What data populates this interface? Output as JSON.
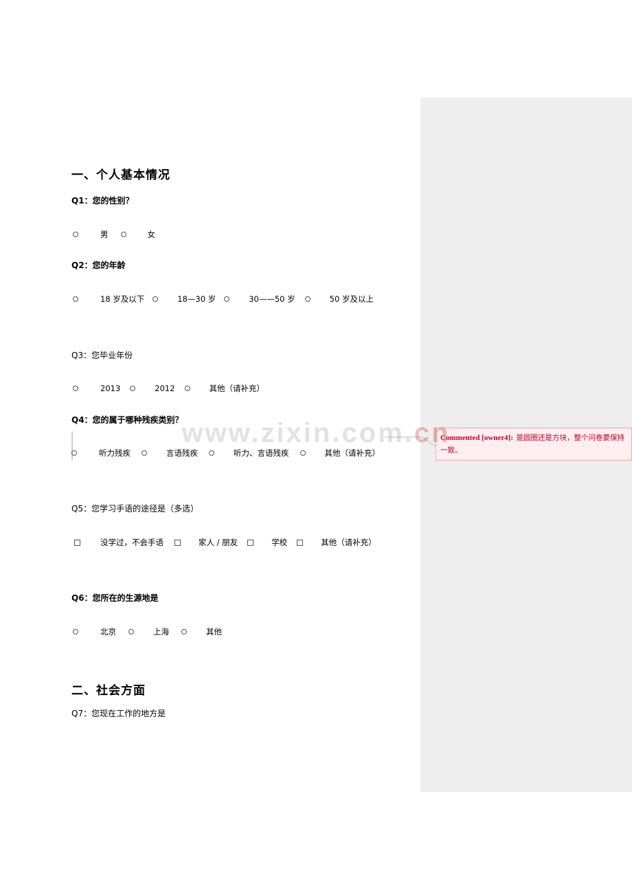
{
  "document": {
    "section1_title": "一、个人基本情况",
    "section2_title": "二、社会方面",
    "questions": [
      {
        "id": "q1",
        "label": "Q1：您的性别？",
        "bold": true,
        "input_type": "radio",
        "options": [
          "男",
          "女"
        ]
      },
      {
        "id": "q2",
        "label": "Q2：您的年龄",
        "bold": true,
        "input_type": "radio",
        "options": [
          "18 岁及以下",
          "18—30 岁",
          "30——50 岁",
          "50 岁及以上"
        ]
      },
      {
        "id": "q3",
        "label": "Q3：您毕业年份",
        "bold": false,
        "input_type": "radio",
        "options": [
          "2013",
          "2012",
          "其他（请补充）"
        ]
      },
      {
        "id": "q4",
        "label": "Q4：您的属于哪种残疾类别？",
        "bold": true,
        "input_type": "radio",
        "options": [
          "听力残疾",
          "言语残疾",
          "听力、言语残疾",
          "其他（请补充）"
        ]
      },
      {
        "id": "q5",
        "label": "Q5：您学习手语的途径是（多选）",
        "bold": false,
        "input_type": "checkbox",
        "options": [
          "没学过，不会手语",
          "家人 / 朋友",
          "学校",
          "其他（请补充）"
        ]
      },
      {
        "id": "q6",
        "label": "Q6：您所在的生源地是",
        "bold": true,
        "input_type": "radio",
        "options": [
          "北京",
          "上海",
          "其他"
        ]
      },
      {
        "id": "q7",
        "label": "Q7：您现在工作的地方是",
        "bold": false,
        "input_type": "none",
        "options": []
      }
    ]
  },
  "comment": {
    "author_label": "Commented [owner4]:",
    "text": "是圆圈还是方块，整个问卷要保持一致。",
    "accent_color": "#c00030",
    "background_color": "#fdeef0",
    "border_color": "#f3a9b4"
  },
  "watermark": {
    "text_left": "www.zixin.com.",
    "text_right": "cn"
  }
}
